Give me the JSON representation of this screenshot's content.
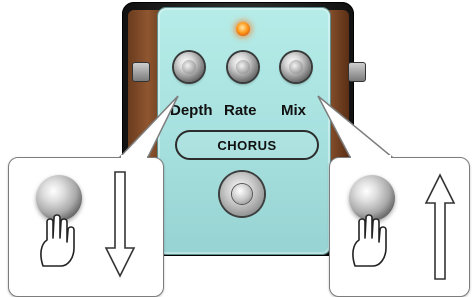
{
  "pedal": {
    "knobs": [
      {
        "label": "Depth"
      },
      {
        "label": "Rate"
      },
      {
        "label": "Mix"
      }
    ],
    "name_plate": "CHORUS",
    "led_color": "#ff8a1a",
    "body_color": "#aee6e3"
  },
  "callouts": {
    "left": {
      "icon": "hand-turning-knob-icon",
      "arrow": "arrow-down-icon"
    },
    "right": {
      "icon": "hand-turning-knob-icon",
      "arrow": "arrow-up-icon"
    }
  }
}
